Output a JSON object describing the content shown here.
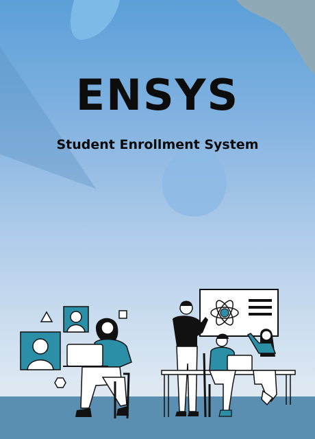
{
  "brand": {
    "logo": "ENSYS",
    "subtitle": "Student Enrollment System"
  },
  "colors": {
    "sky_top": "#5b9fd8",
    "sky_bottom": "#e6edf3",
    "floor": "#5b8fb2",
    "accent_teal": "#2c8fa8",
    "ink": "#0c0c0c"
  },
  "illustration": {
    "left_scene": "student-with-laptop-and-video-call",
    "right_scene": "teacher-with-atom-board-and-students"
  }
}
